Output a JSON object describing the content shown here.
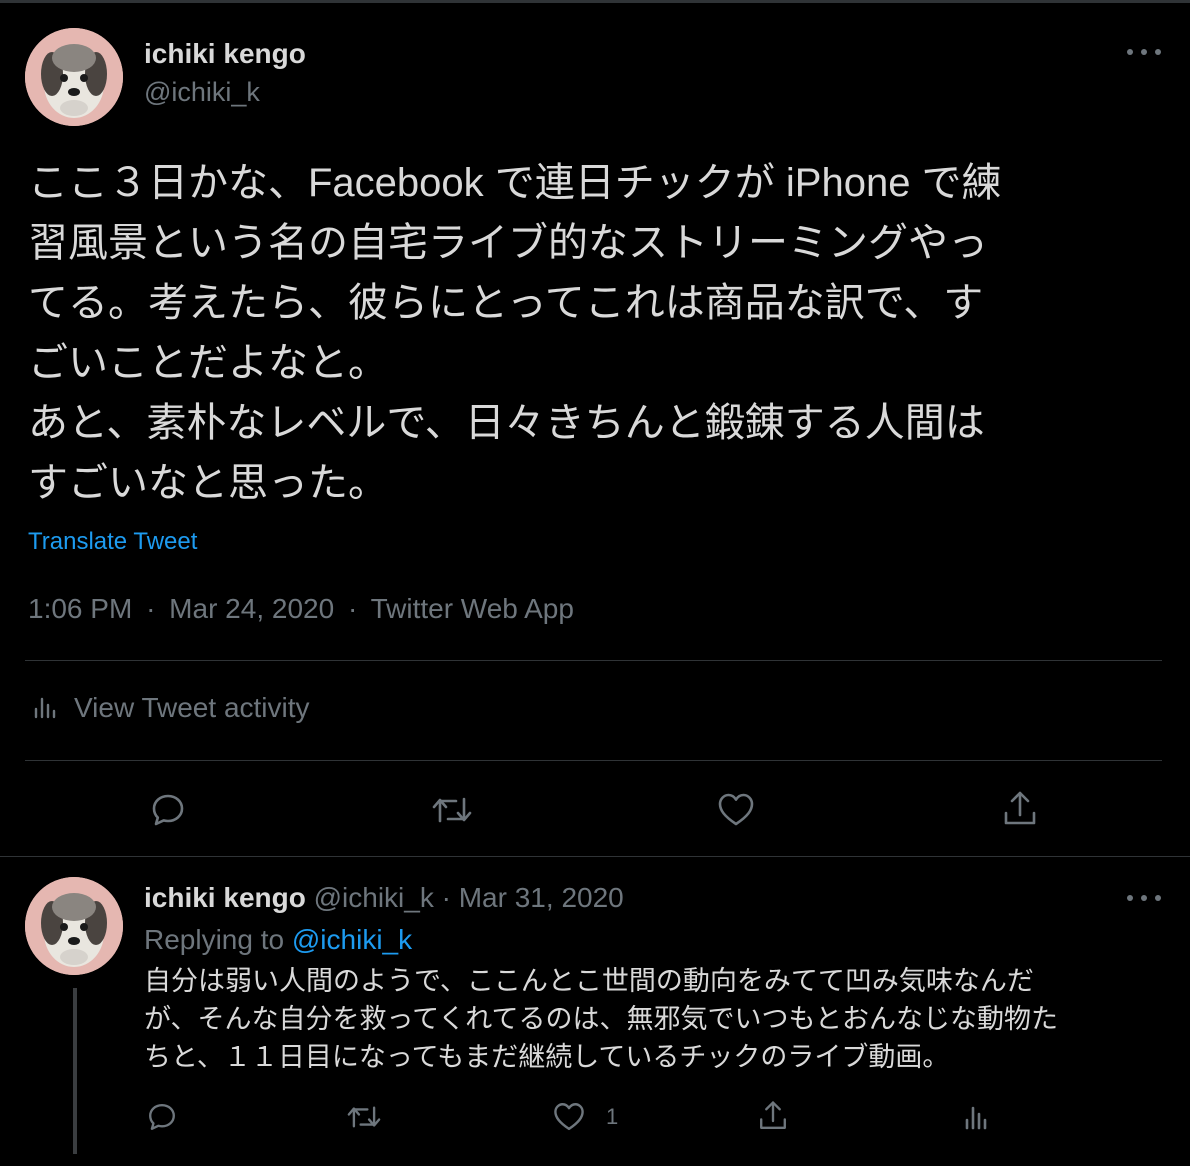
{
  "main_tweet": {
    "display_name": "ichiki kengo",
    "handle": "@ichiki_k",
    "text_lines": [
      "ここ３日かな、Facebook で連日チックが iPhone で練",
      "習風景という名の自宅ライブ的なストリーミングやっ",
      "てる。考えたら、彼らにとってこれは商品な訳で、す",
      "ごいことだよなと。",
      "あと、素朴なレベルで、日々きちんと鍛錬する人間は",
      "すごいなと思った。"
    ],
    "translate_label": "Translate Tweet",
    "time": "1:06 PM",
    "date": "Mar 24, 2020",
    "source": "Twitter Web App",
    "sep": "·",
    "activity_label": "View Tweet activity"
  },
  "reply": {
    "display_name": "ichiki kengo",
    "handle": "@ichiki_k",
    "sep": "·",
    "date": "Mar 31, 2020",
    "replying_prefix": "Replying to ",
    "replying_handle": "@ichiki_k",
    "text_lines": [
      "自分は弱い人間のようで、ここんとこ世間の動向をみてて凹み気味なんだ",
      "が、そんな自分を救ってくれてるのは、無邪気でいつもとおんなじな動物た",
      "ちと、１１日目になってもまだ継続しているチックのライブ動画。"
    ],
    "like_count": "1"
  },
  "icons": {
    "more": "more-horizontal-icon",
    "activity": "analytics-icon",
    "reply": "reply-icon",
    "retweet": "retweet-icon",
    "like": "heart-icon",
    "share": "share-icon"
  },
  "colors": {
    "background": "#000000",
    "text": "#d9d9d9",
    "muted": "#6e767d",
    "accent": "#1d9bf0",
    "divider": "#2f3336"
  }
}
